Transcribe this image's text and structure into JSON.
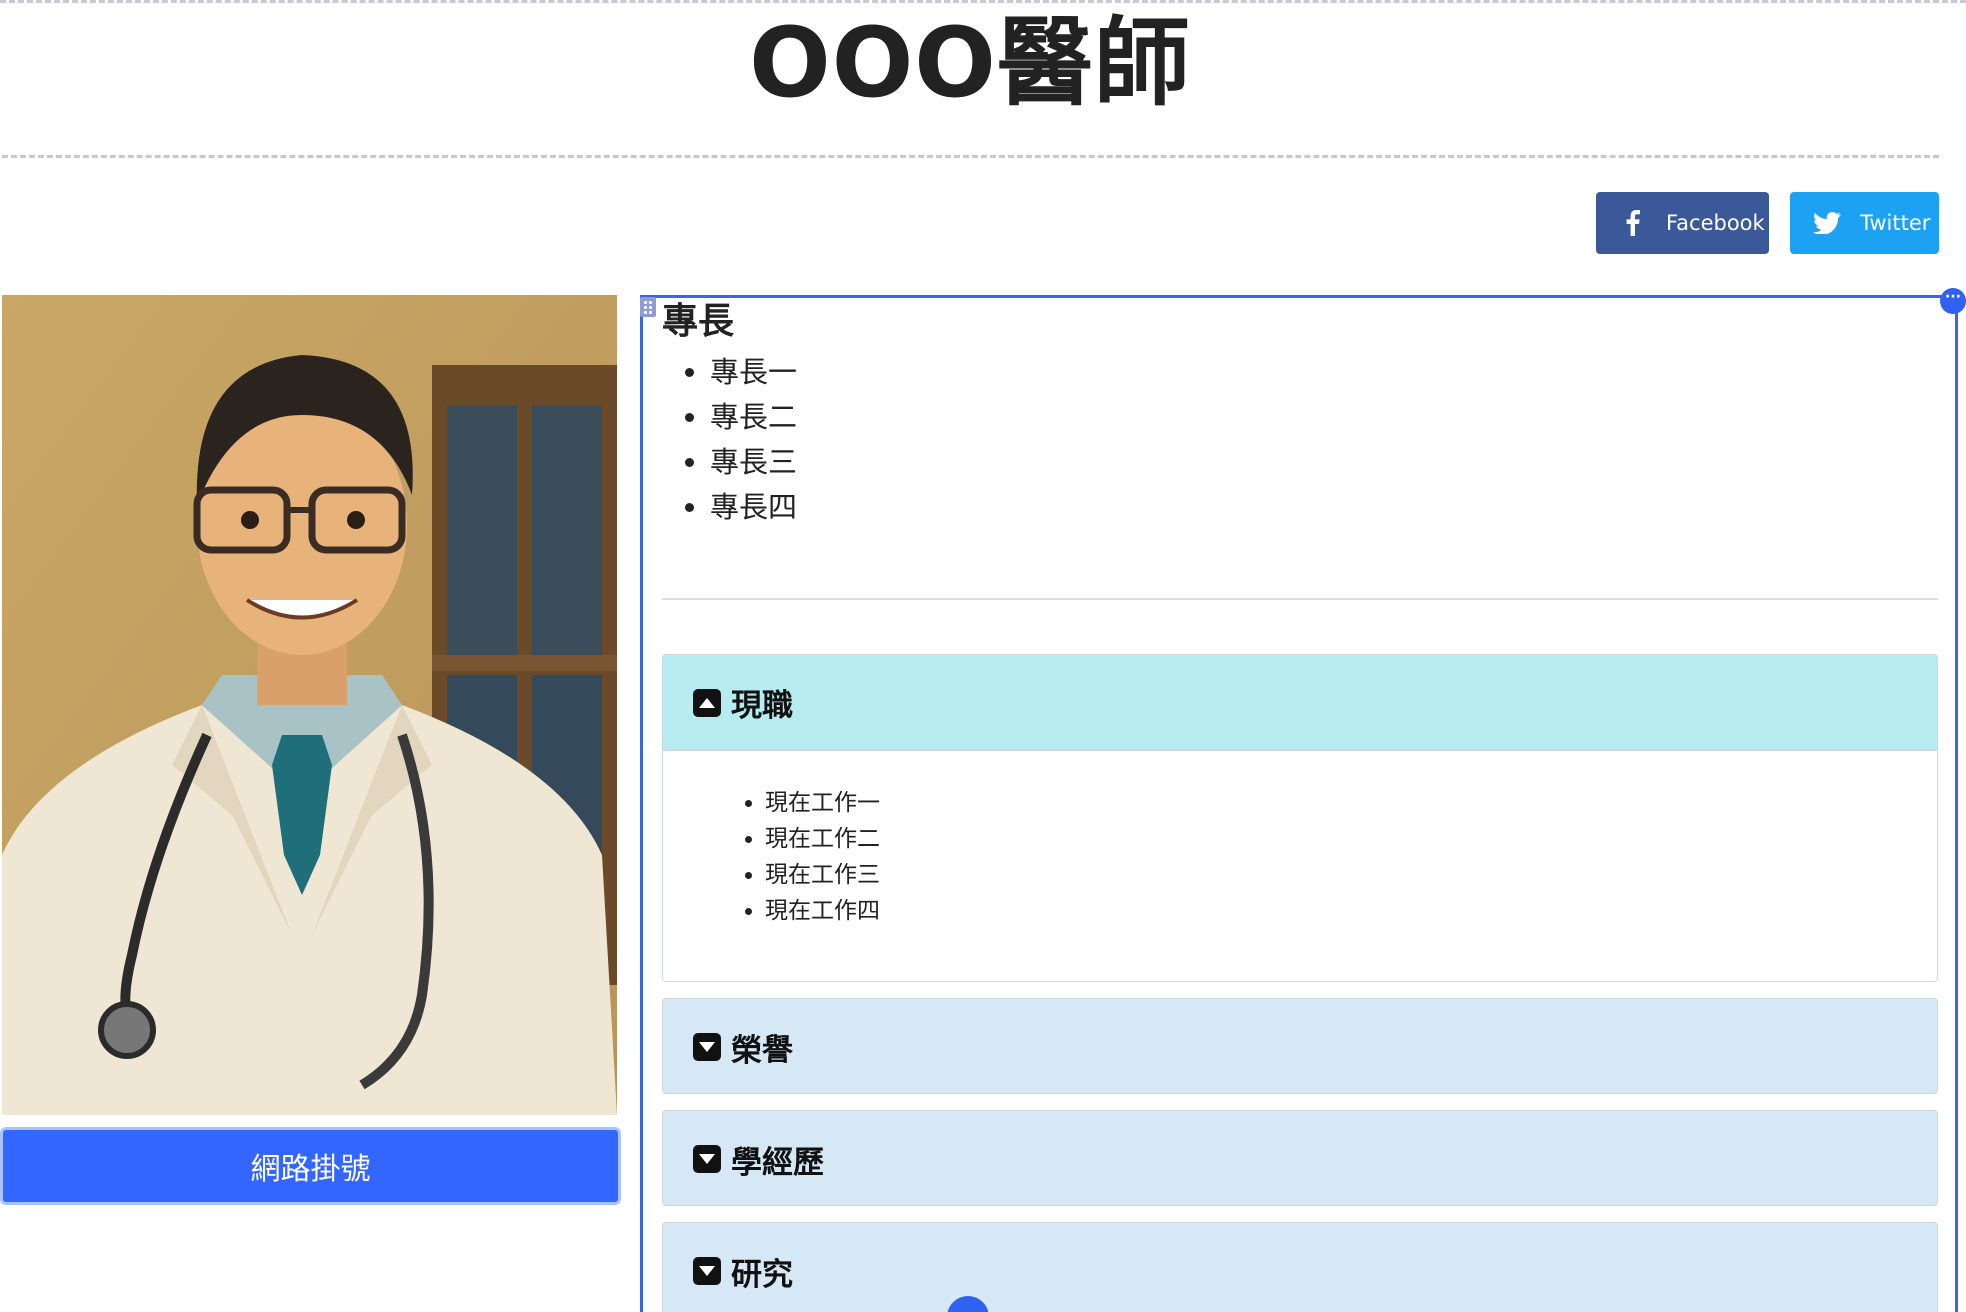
{
  "header": {
    "title": "OOO醫師"
  },
  "social": {
    "facebook_label": "Facebook",
    "twitter_label": "Twitter",
    "facebook_color": "#3b5998",
    "twitter_color": "#1da1f2"
  },
  "profile": {
    "photo_icon": "doctor-illustration",
    "booking_label": "網路掛號"
  },
  "specialties": {
    "heading": "專長",
    "items": [
      "專長一",
      "專長二",
      "專長三",
      "專長四"
    ]
  },
  "accordion": [
    {
      "label": "現職",
      "expanded": true,
      "items": [
        "現在工作一",
        "現在工作二",
        "現在工作三",
        "現在工作四"
      ]
    },
    {
      "label": "榮譽",
      "expanded": false
    },
    {
      "label": "學經歷",
      "expanded": false
    },
    {
      "label": "研究",
      "expanded": false
    }
  ],
  "colors": {
    "accent": "#3366ff",
    "open_panel": "#b6ecef",
    "closed_panel": "#d6e7f6",
    "editor_outline": "#3a66e6"
  }
}
